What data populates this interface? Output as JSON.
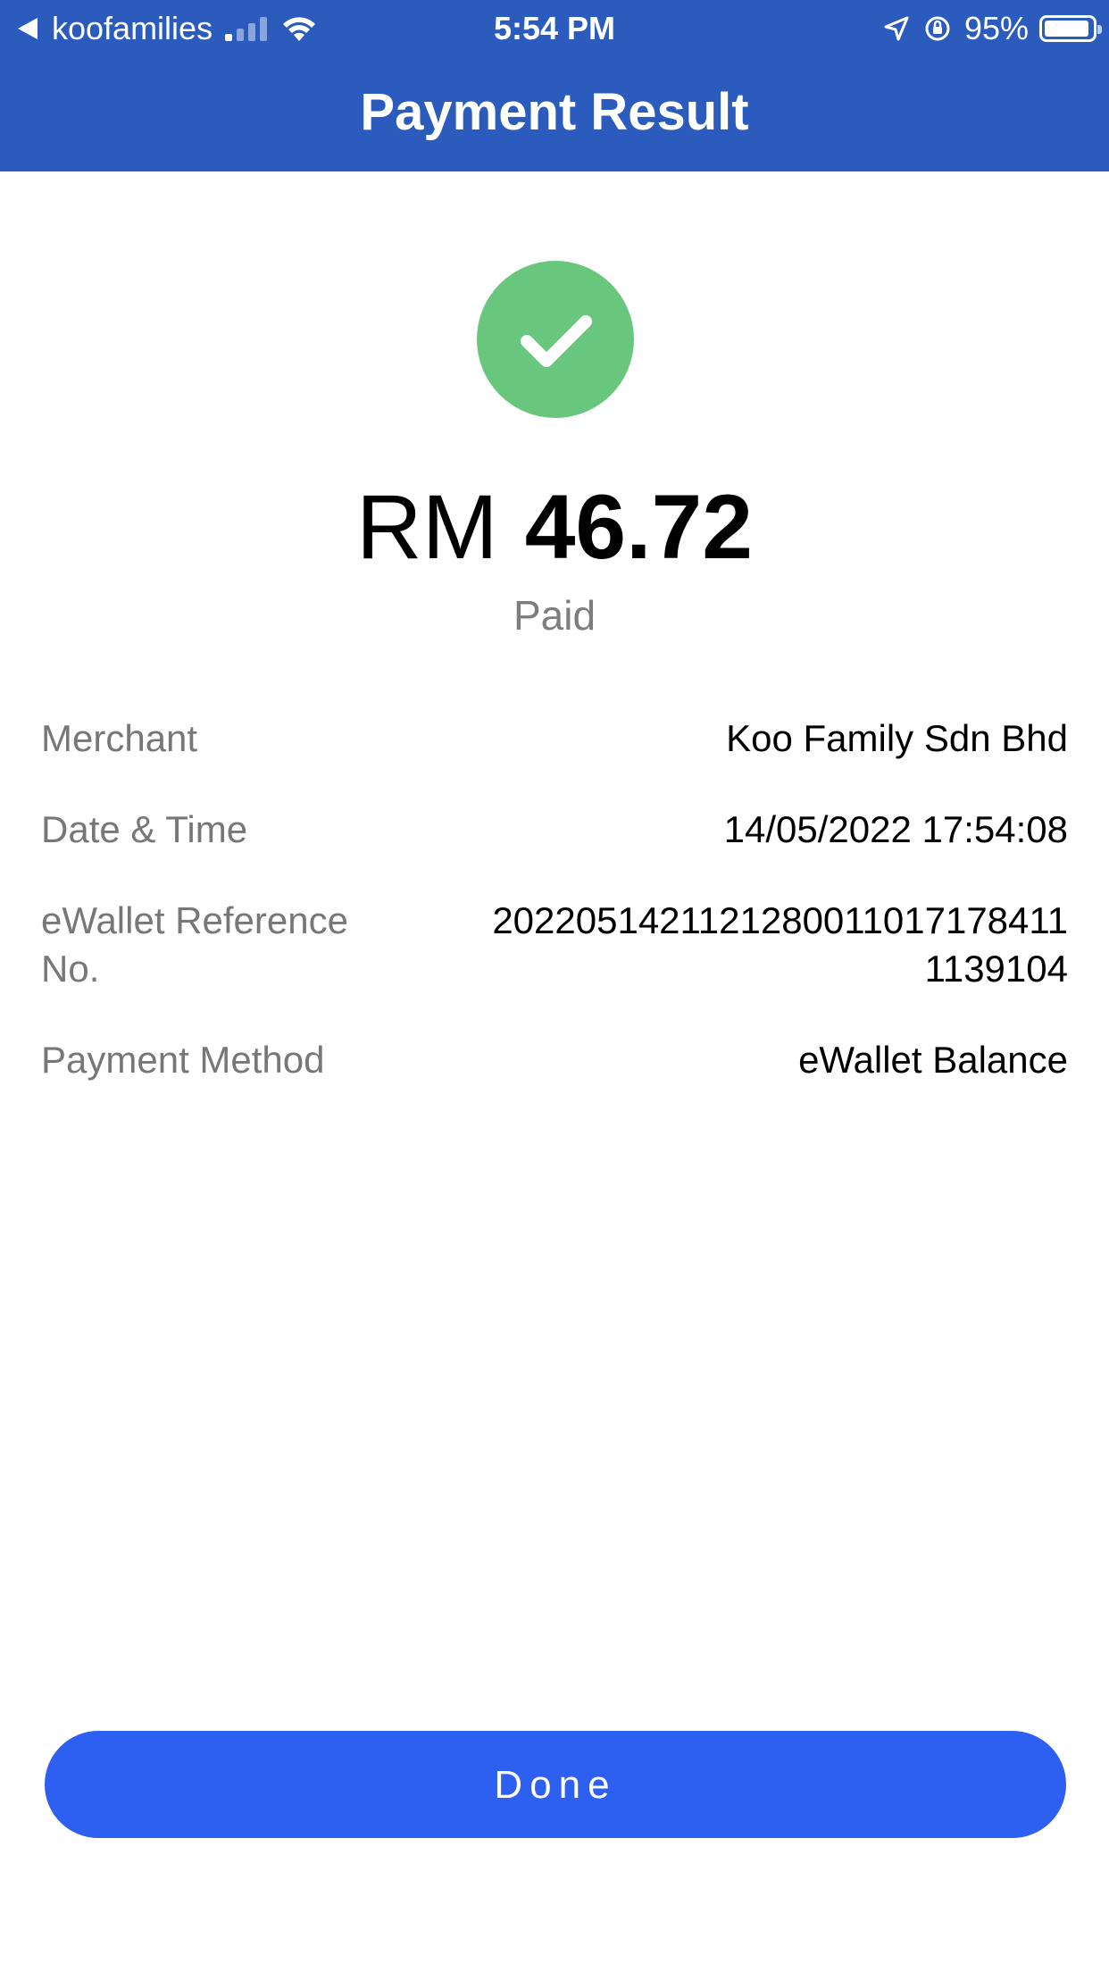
{
  "status_bar": {
    "app_back_label": "koofamilies",
    "time": "5:54 PM",
    "battery": "95%",
    "battery_level": 0.95,
    "signal_bars": 1
  },
  "header": {
    "title": "Payment Result"
  },
  "result": {
    "icon": "checkmark-icon",
    "icon_color": "#68c77d",
    "currency": "RM",
    "amount": "46.72",
    "status": "Paid"
  },
  "details": {
    "merchant": {
      "label": "Merchant",
      "value": "Koo Family Sdn Bhd"
    },
    "datetime": {
      "label": "Date & Time",
      "value": "14/05/2022 17:54:08"
    },
    "reference": {
      "label": "eWallet Reference No.",
      "value_line1": "2022051421121280011017178411",
      "value_line2": "1139104"
    },
    "method": {
      "label": "Payment Method",
      "value": "eWallet Balance"
    }
  },
  "footer": {
    "done_label": "Done"
  },
  "colors": {
    "header_bg": "#2a5bbd",
    "button_bg": "#2d60f0",
    "success": "#68c77d"
  }
}
